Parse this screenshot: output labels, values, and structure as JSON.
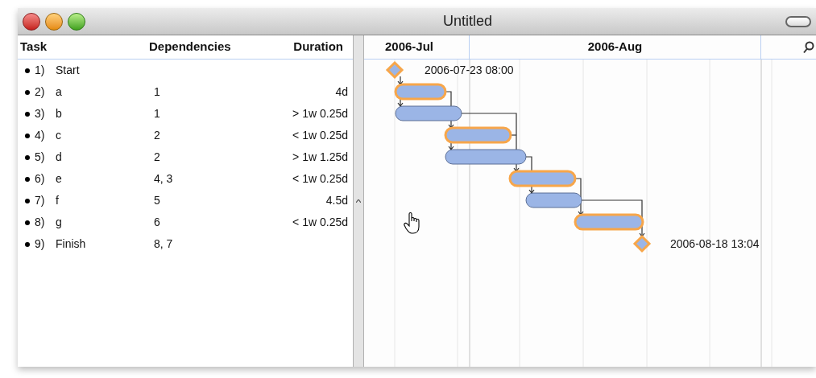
{
  "window": {
    "title": "Untitled"
  },
  "table": {
    "columns": [
      "Task",
      "Dependencies",
      "Duration"
    ]
  },
  "tasks": [
    {
      "number": "1)",
      "name": "Start",
      "critical": true,
      "kind": "milestone",
      "date_label": "2006-07-23 08:00"
    },
    {
      "number": "2)",
      "name": "a",
      "dependencies": "1",
      "duration": "4d",
      "critical": true,
      "kind": "task"
    },
    {
      "number": "3)",
      "name": "b",
      "dependencies": "1",
      "duration": "> 1w 0.25d",
      "critical": false,
      "kind": "task"
    },
    {
      "number": "4)",
      "name": "c",
      "dependencies": "2",
      "duration": "< 1w 0.25d",
      "critical": true,
      "kind": "task"
    },
    {
      "number": "5)",
      "name": "d",
      "dependencies": "2",
      "duration": "> 1w 1.25d",
      "critical": false,
      "kind": "task"
    },
    {
      "number": "6)",
      "name": "e",
      "dependencies": "4, 3",
      "duration": "< 1w 0.25d",
      "critical": true,
      "kind": "task"
    },
    {
      "number": "7)",
      "name": "f",
      "dependencies": "5",
      "duration": "4.5d",
      "critical": false,
      "kind": "task"
    },
    {
      "number": "8)",
      "name": "g",
      "dependencies": "6",
      "duration": "< 1w 0.25d",
      "critical": true,
      "kind": "task"
    },
    {
      "number": "9)",
      "name": "Finish",
      "dependencies": "8, 7",
      "critical": true,
      "kind": "milestone",
      "date_label": "2006-08-18 13:04"
    }
  ],
  "timeline": {
    "months": [
      "2006-Jul",
      "2006-Aug"
    ]
  }
}
